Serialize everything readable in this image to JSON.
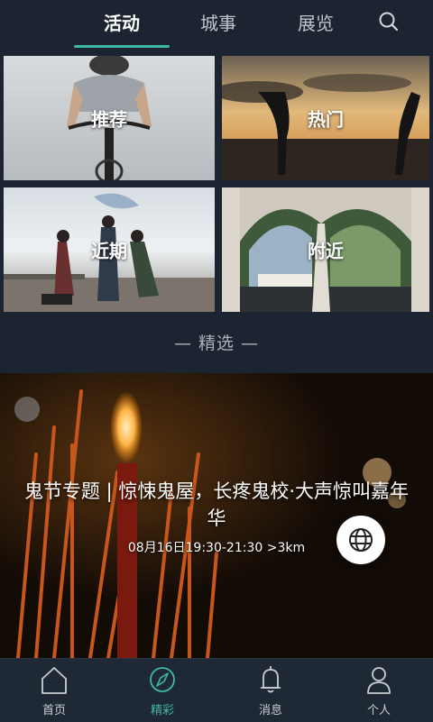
{
  "header": {
    "tabs": [
      {
        "label": "活动",
        "active": true
      },
      {
        "label": "城事",
        "active": false
      },
      {
        "label": "展览",
        "active": false
      }
    ],
    "search_icon": "search-icon"
  },
  "categories": [
    {
      "label": "推荐",
      "scene": "cyclist"
    },
    {
      "label": "热门",
      "scene": "sunset-yoga"
    },
    {
      "label": "近期",
      "scene": "dancers"
    },
    {
      "label": "附近",
      "scene": "arches"
    }
  ],
  "section_title": "— 精选 —",
  "featured": {
    "title": "鬼节专题 | 惊悚鬼屋，长疼鬼校·大声惊叫嘉年华",
    "meta": "08月16日19:30-21:30 >3km",
    "action_icon": "globe-icon"
  },
  "bottom_nav": [
    {
      "label": "首页",
      "icon": "home-icon",
      "active": false
    },
    {
      "label": "精彩",
      "icon": "compass-icon",
      "active": true
    },
    {
      "label": "消息",
      "icon": "bell-icon",
      "active": false
    },
    {
      "label": "个人",
      "icon": "person-icon",
      "active": false
    }
  ],
  "colors": {
    "background": "#1b2430",
    "accent": "#3fb8a8",
    "text": "#ffffff"
  }
}
